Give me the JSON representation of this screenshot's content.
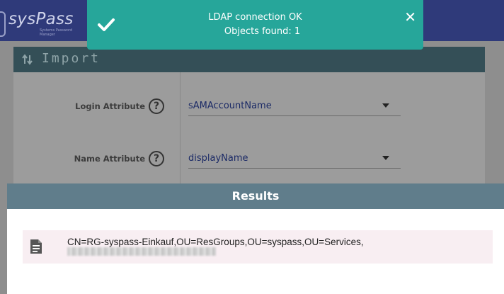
{
  "header": {
    "logo_text": "sysPass",
    "logo_subtitle": "Systems Password Manager"
  },
  "import_panel": {
    "title": "Import",
    "fields": [
      {
        "label": "Login Attribute",
        "value": "sAMAccountName"
      },
      {
        "label": "Name Attribute",
        "value": "displayName"
      }
    ]
  },
  "toast": {
    "line1": "LDAP connection OK",
    "line2": "Objects found: 1",
    "close_label": "✕"
  },
  "results_dialog": {
    "title": "Results",
    "items": [
      {
        "text": "CN=RG-syspass-Einkauf,OU=ResGroups,OU=syspass,OU=Services,"
      }
    ]
  },
  "colors": {
    "toast_bg": "#26a69a",
    "dialog_header_bg": "#607d8b",
    "panel_header_bg": "#344f57",
    "topbar_bg": "#2f3a7a"
  }
}
